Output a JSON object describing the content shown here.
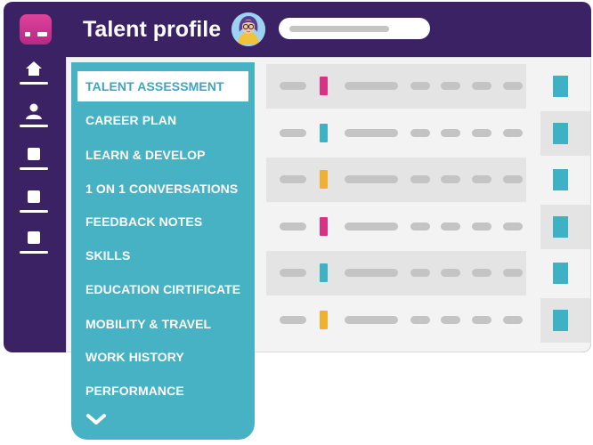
{
  "header": {
    "title": "Talent profile",
    "search_placeholder": ""
  },
  "rail": {
    "items": [
      {
        "icon": "home-icon"
      },
      {
        "icon": "user-icon"
      },
      {
        "icon": "square-icon"
      },
      {
        "icon": "square-icon"
      },
      {
        "icon": "square-icon"
      }
    ]
  },
  "menu": {
    "items": [
      {
        "label": "TALENT ASSESSMENT",
        "active": true
      },
      {
        "label": "CAREER PLAN"
      },
      {
        "label": "LEARN & DEVELOP"
      },
      {
        "label": "1 ON 1 CONVERSATIONS"
      },
      {
        "label": "FEEDBACK NOTES"
      },
      {
        "label": "SKILLS"
      },
      {
        "label": "EDUCATION CIRTIFICATE"
      },
      {
        "label": "MOBILITY & TRAVEL"
      },
      {
        "label": "WORK HISTORY"
      },
      {
        "label": "PERFORMANCE"
      }
    ],
    "more_icon": "chevron-down-icon"
  },
  "table": {
    "rows": [
      {
        "marker_color": "#d63384",
        "shaded": true
      },
      {
        "marker_color": "#3eb1c4",
        "shaded": false
      },
      {
        "marker_color": "#f0b132",
        "shaded": true
      },
      {
        "marker_color": "#d63384",
        "shaded": false
      },
      {
        "marker_color": "#3eb1c4",
        "shaded": true
      },
      {
        "marker_color": "#f0b132",
        "shaded": false
      }
    ]
  },
  "colors": {
    "brand_purple": "#3b2264",
    "teal": "#47b2c4",
    "magenta": "#d63384",
    "yellow": "#f0b132"
  }
}
